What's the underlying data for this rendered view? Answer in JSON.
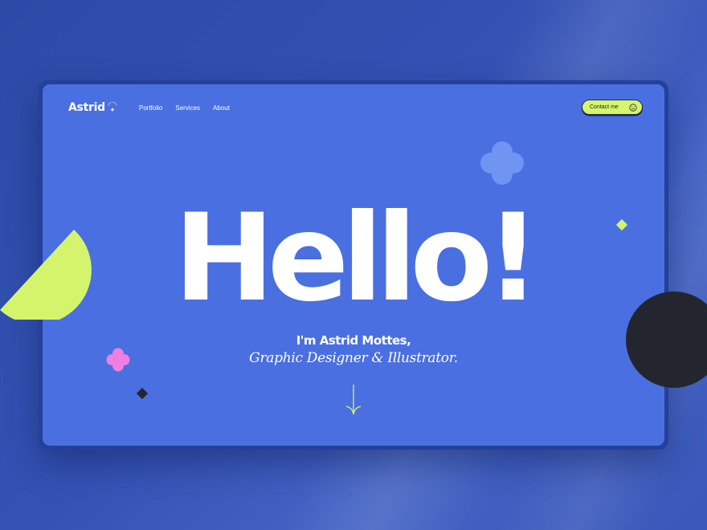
{
  "brand": {
    "name": "Astrid"
  },
  "nav": {
    "items": [
      {
        "label": "Portfolio"
      },
      {
        "label": "Services"
      },
      {
        "label": "About"
      }
    ]
  },
  "contact": {
    "label": "Contact me",
    "icon": "smile-icon"
  },
  "hero": {
    "headline": "Hello!",
    "name_line": "I'm Astrid Mottes,",
    "role_line": "Graphic Designer & Illustrator."
  },
  "scroll": {
    "icon": "arrow-down-icon"
  },
  "colors": {
    "background": "#3452b4",
    "screen": "#4a6fe1",
    "accent_lime": "#d7f56a",
    "dark": "#24262f",
    "pink": "#ef7fe0",
    "flower_blue": "#6f94f2"
  }
}
